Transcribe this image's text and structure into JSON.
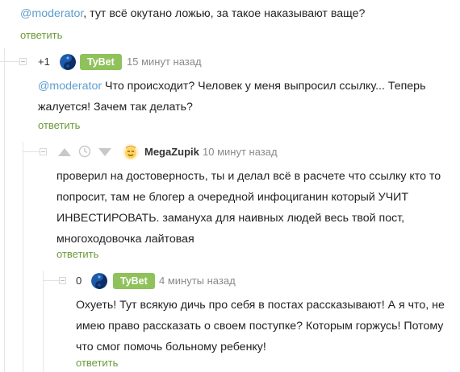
{
  "comment0": {
    "mention": "@moderator",
    "text": ", тут всё окутано ложью, за такое наказывают ваще?",
    "reply": "ответить"
  },
  "comment1": {
    "rating": "+1",
    "badge": "TyBet",
    "time": "15 минут назад",
    "mention": "@moderator",
    "line1": " Что происходит? Человек у меня выпросил ссылку... Теперь",
    "line2": "жалуется! Зачем так делать?",
    "reply": "ответить"
  },
  "comment2": {
    "author": "MegaZupik",
    "time": "10 минут назад",
    "lines": [
      "проверил на достоверность, ты и делал всё в расчете что ссылку кто то",
      "попросит, там не блогер а очередной инфоциганин который УЧИТ",
      "ИНВЕСТИРОВАТЬ. замануха для наивных людей весь твой пост,",
      "многоходовочка лайтовая"
    ],
    "reply": "ответить"
  },
  "comment3": {
    "rating": "0",
    "badge": "TyBet",
    "time": "4 минуты назад",
    "lines": [
      "Охуеть! Тут всякую дичь про себя в постах рассказывают! А я что, не",
      "имею право рассказать о своем поступке? Которым горжусь! Потому",
      "что смог помочь больному ребенку!"
    ],
    "reply": "ответить"
  },
  "colors": {
    "mention": "#5d9ed0",
    "reply": "#6b9b3a",
    "badge": "#8fc25a",
    "time": "#8a8a8a"
  },
  "icons": [
    "collapse-icon",
    "upvote-icon",
    "clock-icon",
    "downvote-icon",
    "yin-yang-avatar-icon",
    "emoji-avatar-icon"
  ]
}
